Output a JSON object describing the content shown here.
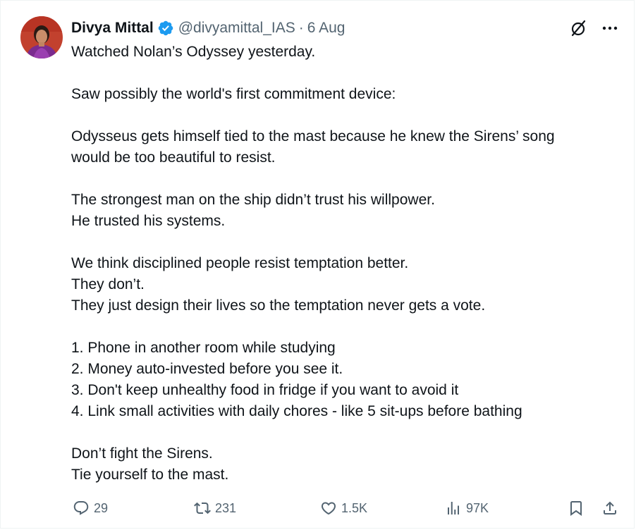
{
  "author": {
    "name": "Divya Mittal",
    "handle": "@divyamittal_IAS",
    "separator": "·",
    "date": "6 Aug"
  },
  "icons": {
    "verified": "verified-badge-icon",
    "grok": "grok-icon",
    "more": "more-options-icon",
    "reply": "reply-icon",
    "retweet": "retweet-icon",
    "like": "like-icon",
    "views": "views-icon",
    "bookmark": "bookmark-icon",
    "share": "share-icon"
  },
  "colors": {
    "verified": "#1d9bf0",
    "text": "#0f1419",
    "secondary": "#536471"
  },
  "body": {
    "line1": "Watched Nolan’s Odyssey yesterday.",
    "line2": "Saw possibly the world's first commitment device:",
    "line3": "Odysseus gets himself tied to the mast because he knew the Sirens’ song",
    "line4": "would be too beautiful to resist.",
    "line5": "The strongest man on the ship didn’t trust his willpower.",
    "line6": "He trusted his systems.",
    "line7": "We think disciplined people resist temptation better.",
    "line8": "They don’t.",
    "line9": "They just design their lives so the temptation never gets a vote.",
    "list": [
      "1. Phone in another room while studying",
      "2. Money auto-invested before you see it.",
      "3. Don't keep unhealthy food in fridge if you want to avoid it",
      "4. Link small activities with daily chores - like 5 sit-ups before bathing"
    ],
    "line10": "Don’t fight the Sirens.",
    "line11": "Tie yourself to the mast."
  },
  "stats": {
    "replies": "29",
    "retweets": "231",
    "likes": "1.5K",
    "views": "97K"
  }
}
